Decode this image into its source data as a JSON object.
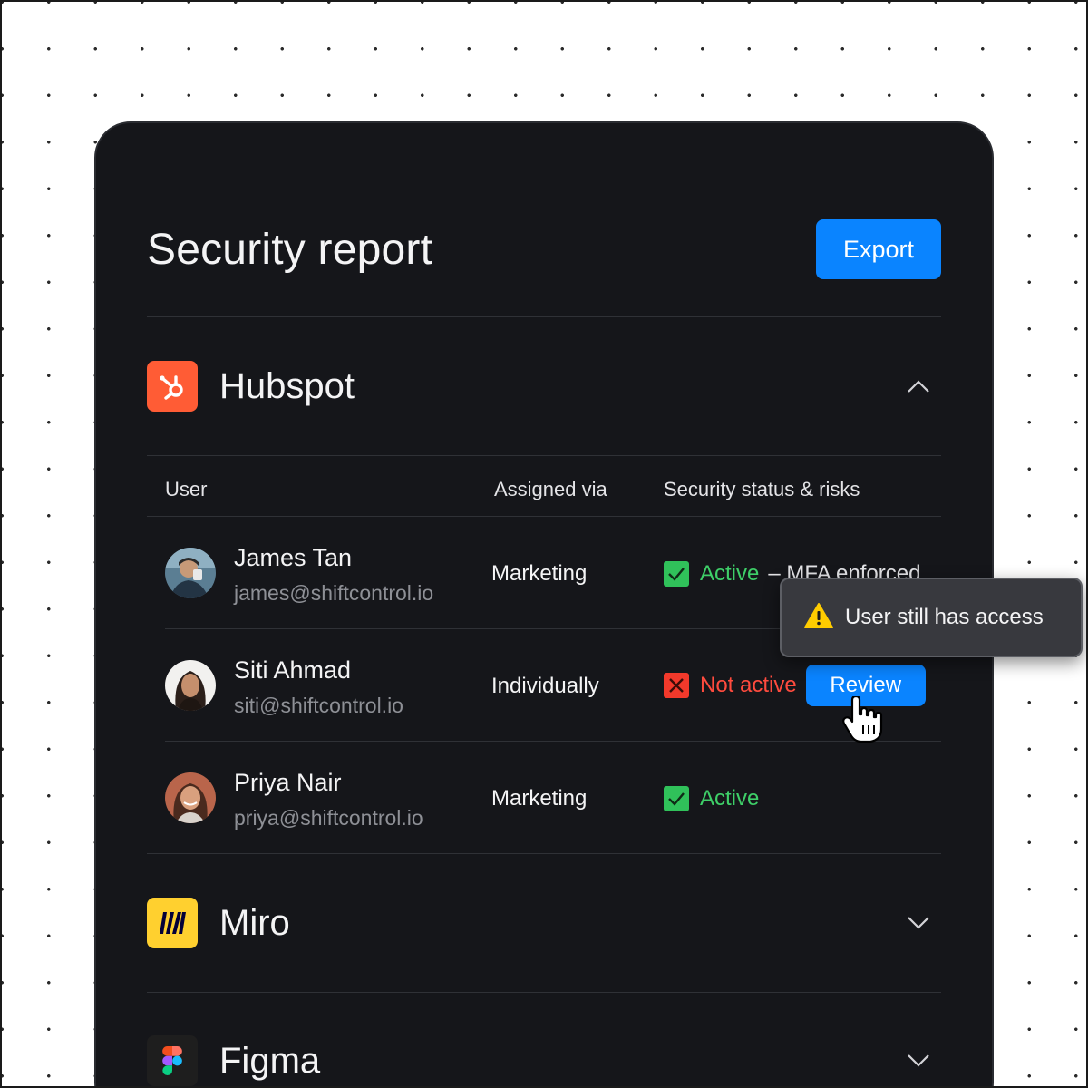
{
  "header": {
    "title": "Security report",
    "export_label": "Export"
  },
  "apps": [
    {
      "name": "Hubspot",
      "logo_icon": "hubspot-logo-icon",
      "logo_color": "#ff5c35",
      "expanded": true,
      "columns": [
        "User",
        "Assigned via",
        "Security status & risks"
      ],
      "users": [
        {
          "name": "James Tan",
          "email": "james@shiftcontrol.io",
          "assigned_via": "Marketing",
          "status": "Active",
          "status_kind": "ok",
          "status_extra": "– MFA enforced"
        },
        {
          "name": "Siti Ahmad",
          "email": "siti@shiftcontrol.io",
          "assigned_via": "Individually",
          "status": "Not active",
          "status_kind": "bad",
          "action_label": "Review"
        },
        {
          "name": "Priya Nair",
          "email": "priya@shiftcontrol.io",
          "assigned_via": "Marketing",
          "status": "Active",
          "status_kind": "ok"
        }
      ]
    },
    {
      "name": "Miro",
      "logo_icon": "miro-logo-icon",
      "logo_color": "#ffd02f",
      "expanded": false
    },
    {
      "name": "Figma",
      "logo_icon": "figma-logo-icon",
      "logo_color": "#1e1e1e",
      "expanded": false
    }
  ],
  "tooltip": {
    "text": "User still has access",
    "icon": "warning-icon"
  },
  "colors": {
    "accent": "#0a84ff",
    "card_bg": "#15161a",
    "ok": "#30c15a",
    "bad": "#f2392b"
  }
}
